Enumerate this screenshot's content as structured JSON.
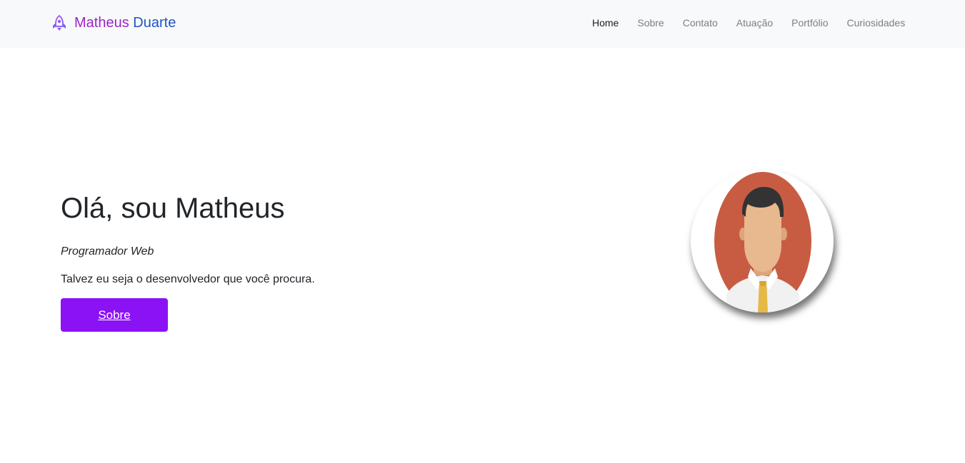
{
  "brand": {
    "first_name": "Matheus",
    "last_name": "Duarte",
    "icon": "rocket-icon",
    "colors": {
      "first": "#9b25c9",
      "last": "#1f55c8"
    }
  },
  "nav": {
    "items": [
      {
        "label": "Home",
        "active": true
      },
      {
        "label": "Sobre",
        "active": false
      },
      {
        "label": "Contato",
        "active": false
      },
      {
        "label": "Atuação",
        "active": false
      },
      {
        "label": "Portfólio",
        "active": false
      },
      {
        "label": "Curiosidades",
        "active": false
      }
    ]
  },
  "hero": {
    "title": "Olá, sou Matheus",
    "role": "Programador Web",
    "description": "Talvez eu seja o desenvolvedor que você procura.",
    "button_label": "Sobre",
    "button_color": "#8a12f5"
  },
  "avatar": {
    "icon": "profile-avatar-illustration",
    "background_color": "#c85c42"
  }
}
